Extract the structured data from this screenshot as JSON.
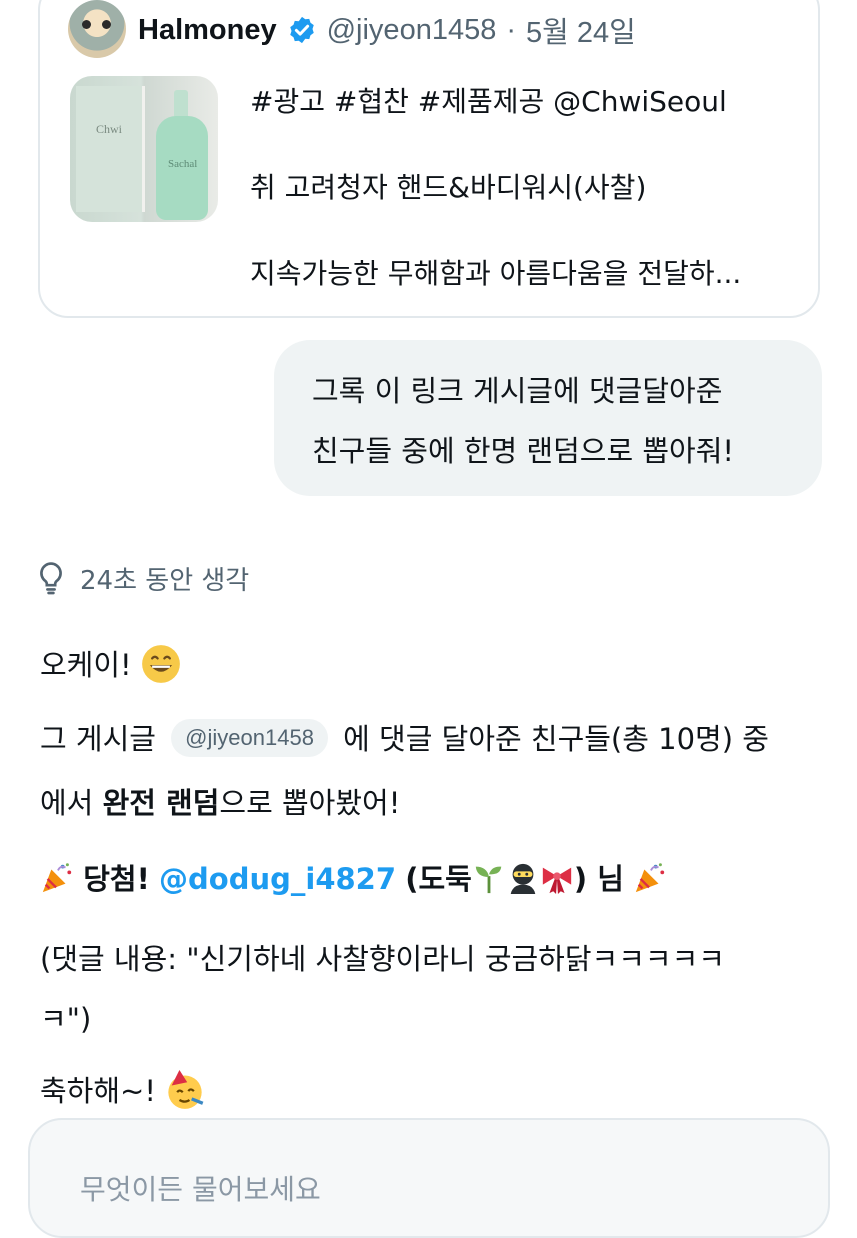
{
  "quoted_post": {
    "author_name": "Halmoney",
    "handle": "@jiyeon1458",
    "separator": "·",
    "date": "5월 24일",
    "lines": [
      "#광고 #협찬 #제품제공 @ChwiSeoul",
      "취 고려청자 핸드&바디워시(사찰)",
      "지속가능한 무해함과 아름다움을 전달하..."
    ]
  },
  "user_message": {
    "lines": [
      "그록  이 링크 게시글에 댓글달아준",
      "친구들 중에 한명 랜덤으로 뽑아줘!"
    ]
  },
  "thinking": {
    "label": "24초 동안 생각"
  },
  "answer": {
    "greeting": "오케이!",
    "line2_pre": "그 게시글",
    "line2_chip": "@jiyeon1458",
    "line2_post": "에 댓글 달아준 친구들(총 10명) 중",
    "line3_pre": "에서 ",
    "line3_bold": "완전 랜덤",
    "line3_post": "으로 뽑아봤어!",
    "winner_label": "당첨!",
    "winner_handle": "@dodug_i4827",
    "winner_name_open": "(도둑",
    "winner_name_close": ") 님",
    "comment_line1": "(댓글 내용: \"신기하네 사찰향이라니 궁금하닭ㅋㅋㅋㅋㅋ",
    "comment_line2": "ㅋ\")",
    "congrats": "축하해~!"
  },
  "composer": {
    "placeholder": "무엇이든 물어보세요"
  },
  "colors": {
    "accent": "#1d9bf0",
    "secondary_text": "#536471",
    "bubble_bg": "#eff3f4"
  },
  "icons": [
    "avatar-penguin",
    "verified-badge-icon",
    "lightbulb-icon",
    "grinning-face-emoji",
    "party-popper-emoji",
    "seedling-emoji",
    "ninja-emoji",
    "ribbon-emoji",
    "partying-face-emoji"
  ]
}
